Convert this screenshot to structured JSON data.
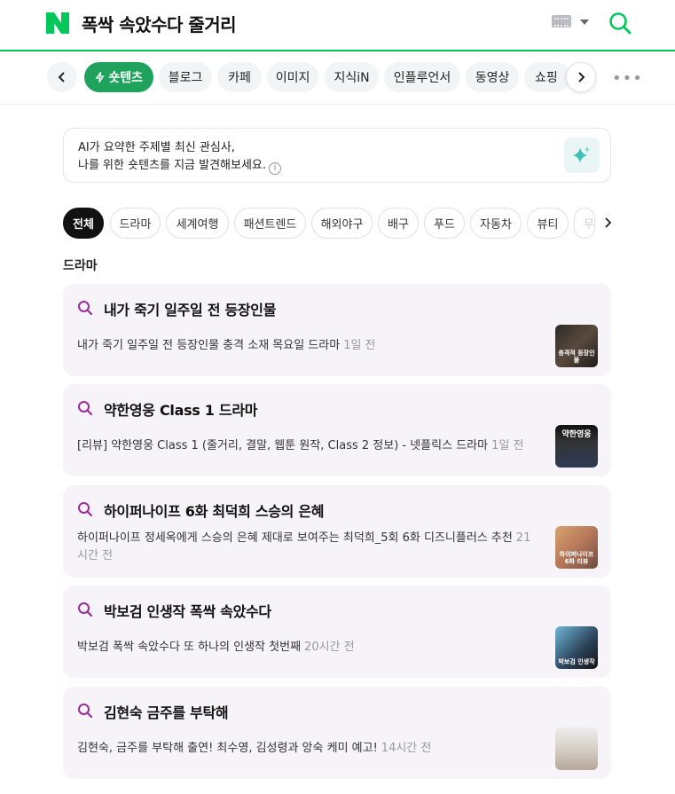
{
  "header": {
    "query": "폭싹 속았수다 줄거리",
    "logo": "naver-n-logo",
    "brand_color": "#03c75a"
  },
  "tabs": {
    "items": [
      {
        "label": "숏텐츠",
        "active": true
      },
      {
        "label": "블로그"
      },
      {
        "label": "카페"
      },
      {
        "label": "이미지"
      },
      {
        "label": "지식iN"
      },
      {
        "label": "인플루언서"
      },
      {
        "label": "동영상"
      },
      {
        "label": "쇼핑"
      }
    ],
    "more": "•••"
  },
  "ai_box": {
    "line1": "AI가 요약한 주제별 최신 관심사,",
    "line2": "나를 위한 숏텐츠를 지금 발견해보세요.",
    "info": "i"
  },
  "chips": [
    {
      "label": "전체",
      "active": true
    },
    {
      "label": "드라마"
    },
    {
      "label": "세계여행"
    },
    {
      "label": "패션트렌드"
    },
    {
      "label": "해외야구"
    },
    {
      "label": "배구"
    },
    {
      "label": "푸드"
    },
    {
      "label": "자동차"
    },
    {
      "label": "뷰티"
    },
    {
      "label": "무"
    }
  ],
  "section": {
    "label": "드라마"
  },
  "cards": [
    {
      "title": "내가 죽기 일주일 전 등장인물",
      "desc": "내가 죽기 일주일 전 등장인물 충격 소재 목요일 드라마",
      "time": "1일 전",
      "thumb_caption": "충격적 등장인물"
    },
    {
      "title": "약한영웅 Class 1 드라마",
      "desc": "[리뷰] 약한영웅 Class 1 (줄거리, 결말, 웹툰 원작, Class 2 정보) - 넷플릭스 드라마",
      "time": "1일 전",
      "thumb_caption": "약한영웅"
    },
    {
      "title": "하이퍼나이프 6화 최덕희 스승의 은혜",
      "desc": "하이퍼나이프 정세옥에게 스승의 은혜 제대로 보여주는 최덕희_5회 6화 디즈니플러스 추천",
      "time": "21시간 전",
      "thumb_caption": "하이퍼나이프 6화 리뷰"
    },
    {
      "title": "박보검 인생작 폭싹 속았수다",
      "desc": "박보검 폭싹 속았수다 또 하나의 인생작 첫번째",
      "time": "20시간 전",
      "thumb_caption": "박보검 인생작"
    },
    {
      "title": "김현숙 금주를 부탁해",
      "desc": "김현숙, 금주를 부탁해 출연! 최수영, 김성령과 앙숙 케미 예고!",
      "time": "14시간 전",
      "thumb_caption": ""
    }
  ]
}
